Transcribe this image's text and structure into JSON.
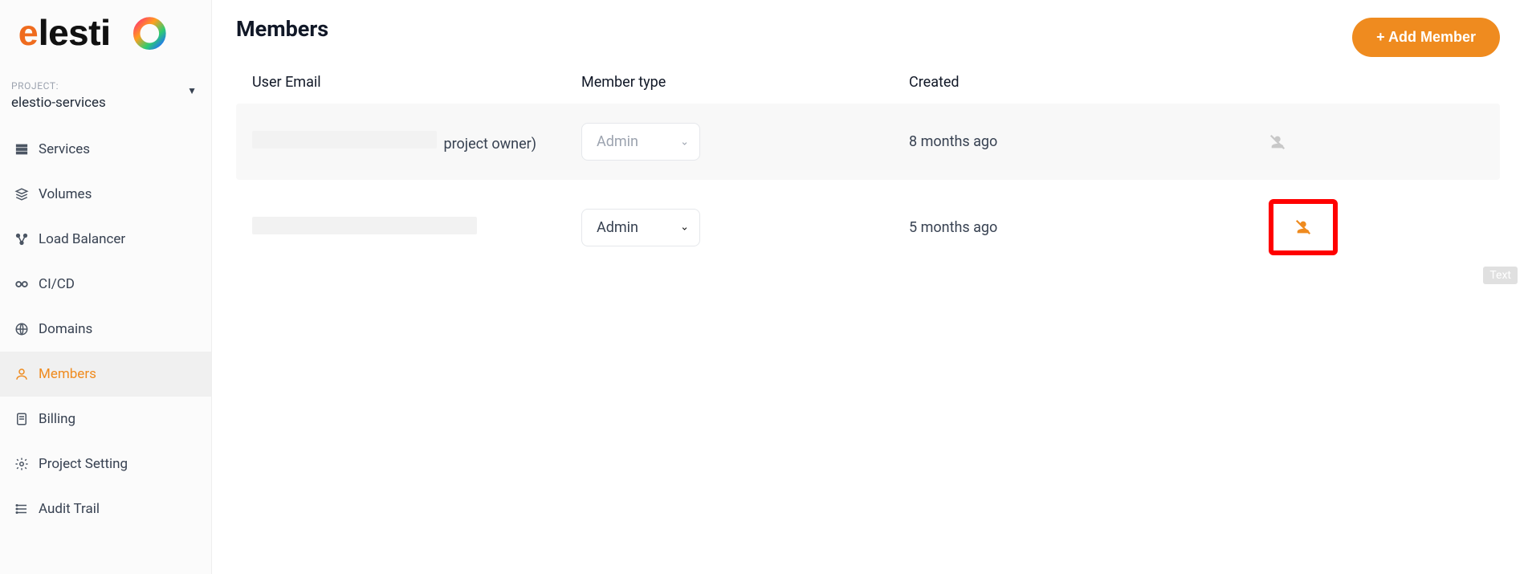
{
  "sidebar": {
    "project_label": "PROJECT:",
    "project_name": "elestio-services",
    "items": [
      {
        "label": "Services"
      },
      {
        "label": "Volumes"
      },
      {
        "label": "Load Balancer"
      },
      {
        "label": "CI/CD"
      },
      {
        "label": "Domains"
      },
      {
        "label": "Members"
      },
      {
        "label": "Billing"
      },
      {
        "label": "Project Setting"
      },
      {
        "label": "Audit Trail"
      }
    ]
  },
  "page": {
    "title": "Members",
    "add_button": "+ Add Member"
  },
  "table": {
    "headers": {
      "email": "User Email",
      "type": "Member type",
      "created": "Created"
    },
    "rows": [
      {
        "owner_suffix": "project owner)",
        "type_value": "Admin",
        "created": "8 months ago",
        "type_disabled": true,
        "action_disabled": true
      },
      {
        "owner_suffix": "",
        "type_value": "Admin",
        "created": "5 months ago",
        "type_disabled": false,
        "action_disabled": false
      }
    ]
  },
  "floating": {
    "text_badge": "Text"
  }
}
